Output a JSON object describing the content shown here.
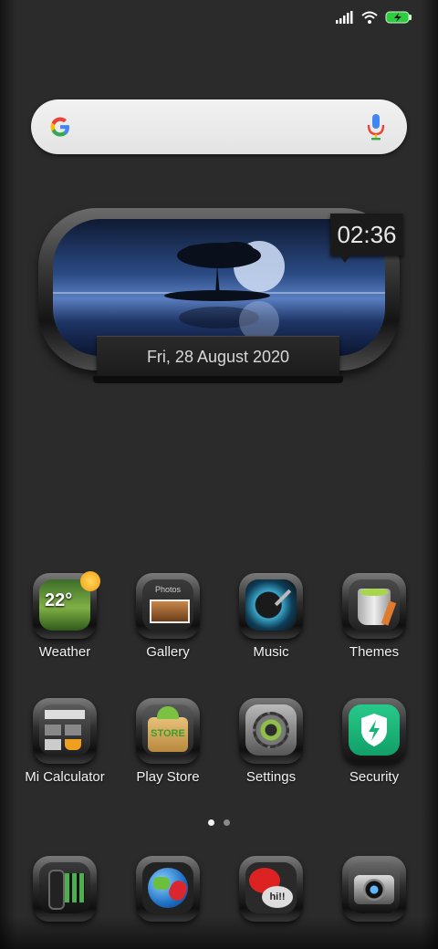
{
  "status_bar": {
    "signal_icon": "signal-icon",
    "wifi_icon": "wifi-icon",
    "battery_icon": "battery-charging-icon"
  },
  "search": {
    "placeholder": "",
    "google_icon": "google-logo-icon",
    "mic_icon": "mic-icon"
  },
  "clock_widget": {
    "time": "02:36",
    "date": "Fri, 28 August 2020"
  },
  "apps_row1": [
    {
      "label": "Weather",
      "badge": "22°"
    },
    {
      "label": "Gallery",
      "badge": "Photos"
    },
    {
      "label": "Music"
    },
    {
      "label": "Themes"
    }
  ],
  "apps_row2": [
    {
      "label": "Mi Calculator"
    },
    {
      "label": "Play Store",
      "badge": "STORE"
    },
    {
      "label": "Settings"
    },
    {
      "label": "Security"
    }
  ],
  "page_indicator": {
    "pages": 2,
    "active": 1
  },
  "dock": [
    {
      "icon": "phone-app-icon"
    },
    {
      "icon": "browser-app-icon"
    },
    {
      "icon": "messaging-app-icon",
      "badge": "hi!!"
    },
    {
      "icon": "camera-app-icon"
    }
  ]
}
